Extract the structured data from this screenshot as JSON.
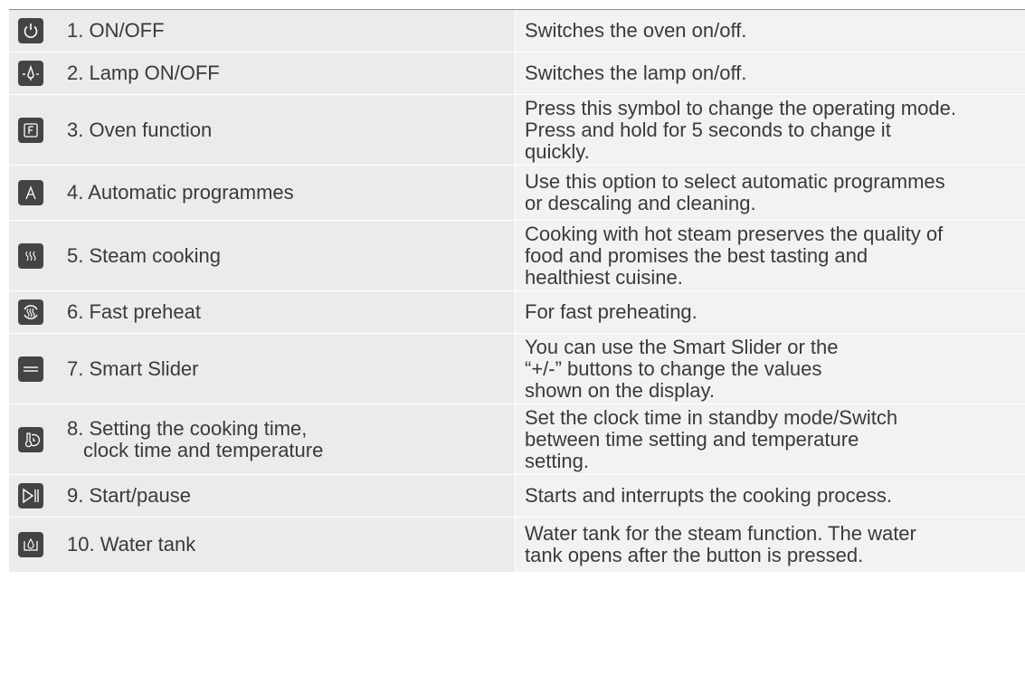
{
  "rows": [
    {
      "icon": "power-icon",
      "label": "1. ON/OFF",
      "desc": [
        "Switches the oven on/off."
      ]
    },
    {
      "icon": "lamp-icon",
      "label": "2. Lamp ON/OFF",
      "desc": [
        "Switches the lamp on/off."
      ]
    },
    {
      "icon": "oven-function-icon",
      "label": "3. Oven function",
      "desc": [
        "Press this symbol to change the operating mode.",
        "Press and hold for 5 seconds to change it",
        "quickly."
      ]
    },
    {
      "icon": "automatic-programmes-icon",
      "label": "4. Automatic programmes",
      "desc": [
        "Use this option to select automatic programmes",
        "or descaling and cleaning."
      ]
    },
    {
      "icon": "steam-icon",
      "label": "5. Steam cooking",
      "desc": [
        "Cooking with hot steam preserves the quality of",
        "food and promises the best tasting and",
        "healthiest cuisine."
      ]
    },
    {
      "icon": "fast-preheat-icon",
      "label": "6. Fast preheat",
      "desc": [
        "For fast preheating."
      ]
    },
    {
      "icon": "smart-slider-icon",
      "label": "7. Smart Slider",
      "desc": [
        "You can use the Smart Slider or the",
        "“+/-” buttons to change the values",
        "shown on the display."
      ]
    },
    {
      "icon": "time-temperature-icon",
      "label": "8. Setting the cooking time,",
      "label2": "clock time and temperature",
      "desc": [
        "Set the clock time in standby mode/Switch",
        "between time setting and temperature",
        "setting."
      ]
    },
    {
      "icon": "start-pause-icon",
      "label": "9. Start/pause",
      "desc": [
        "Starts and interrupts the cooking process."
      ]
    },
    {
      "icon": "water-tank-icon",
      "label": "10. Water tank",
      "desc": [
        "Water tank for the steam function. The water",
        "tank opens after the button is pressed."
      ]
    }
  ]
}
